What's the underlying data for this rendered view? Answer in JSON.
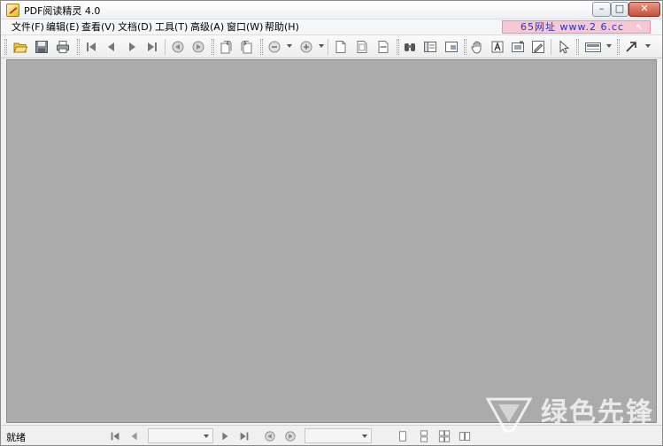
{
  "window": {
    "title": "PDF阅读精灵 4.0",
    "controls": {
      "minimize": "–",
      "maximize": "□",
      "close": "✕"
    }
  },
  "menu": {
    "items": [
      {
        "label": "文件(F)"
      },
      {
        "label": "编辑(E)"
      },
      {
        "label": "查看(V)"
      },
      {
        "label": "文档(D)"
      },
      {
        "label": "工具(T)"
      },
      {
        "label": "高级(A)"
      },
      {
        "label": "窗口(W)"
      },
      {
        "label": "帮助(H)"
      }
    ],
    "ad_banner": "65网址  www.2  6.cc",
    "ad_cursor": "↖"
  },
  "toolbar": {
    "icons": [
      "open-folder-icon",
      "save-icon",
      "print-icon",
      "first-page-icon",
      "prev-page-icon",
      "next-page-icon",
      "last-page-icon",
      "back-icon",
      "forward-icon",
      "rotate-left-icon",
      "rotate-right-icon",
      "zoom-out-icon",
      "zoom-in-icon",
      "actual-size-icon",
      "fit-page-icon",
      "fit-width-icon",
      "find-icon",
      "bookmark-panel-icon",
      "thumbnail-icon",
      "hand-icon",
      "select-text-icon",
      "snapshot-icon",
      "edit-tool-icon",
      "pointer-icon",
      "stamp-icon",
      "arrow-tool-icon"
    ]
  },
  "statusbar": {
    "status": "就绪"
  },
  "watermark": {
    "text": "绿色先锋"
  },
  "colors": {
    "doc_background": "#ababab",
    "ad_background": "#f6c8d6",
    "ad_text": "#1a34d6",
    "close_button": "#c74f3a"
  }
}
